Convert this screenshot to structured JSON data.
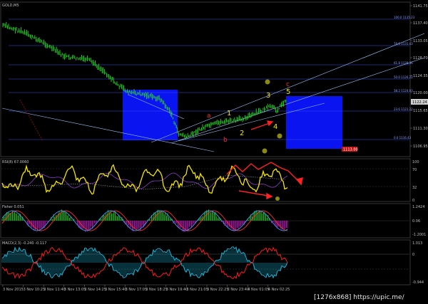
{
  "window": {
    "symbol_title": "GOLD,M5"
  },
  "price_axis": {
    "ticks": [
      "1141.75",
      "1137.40",
      "1133.05",
      "1128.70",
      "1124.35",
      "1120.00",
      "1115.65",
      "1111.30",
      "1106.95"
    ],
    "current_price": "1122.24",
    "pending_label": "1113.00"
  },
  "fib_levels": [
    {
      "label": "100.0 1135.23"
    },
    {
      "label": "78.6 1131.43"
    },
    {
      "label": "61.8 1128.36"
    },
    {
      "label": "50.0 1126.22"
    },
    {
      "label": "38.2 1124.03"
    },
    {
      "label": "23.6 1121.22"
    },
    {
      "label": "0.0 1116.43"
    }
  ],
  "wave_labels": {
    "yellow": [
      "1",
      "2",
      "3",
      "4",
      "5"
    ],
    "red": [
      "a",
      "b",
      "c"
    ]
  },
  "indicators": {
    "rsi": {
      "title": "RSI(8) 67.0060",
      "ticks": [
        "100",
        "70",
        "32",
        "0"
      ]
    },
    "fisher": {
      "title": "Fisher 0.051",
      "ticks": [
        "1.2424",
        "0.06",
        "-1.2001"
      ]
    },
    "macd": {
      "title": "MACD(2,3) -0.240 -0.117",
      "ticks": [
        "1.013",
        "0",
        "-0.944"
      ]
    }
  },
  "time_axis": [
    "3 Nov 2015",
    "3 Nov 10:25",
    "3 Nov 11:40",
    "3 Nov 13:05",
    "3 Nov 14:25",
    "3 Nov 15:40",
    "3 Nov 17:05",
    "3 Nov 18:25",
    "3 Nov 19:40",
    "3 Nov 21:05",
    "3 Nov 22:25",
    "3 Nov 23:40",
    "4 Nov 01:05",
    "4 Nov 02:25"
  ],
  "watermark": "[1276x868] https://upic.me/",
  "colors": {
    "background": "#000000",
    "bull_candle": "#2bd62b",
    "blue_box": "#0a14f0",
    "fib_line": "#3a50e8",
    "trend_line": "#9ec8ff",
    "rsi_line": "#f5e600",
    "red_accent": "#ff2020",
    "olive_marker": "#8a8a14",
    "macd_cyan": "#1ab3d4",
    "macd_red": "#ff1a1a"
  },
  "chart_data": {
    "type": "line",
    "title": "GOLD,M5",
    "xlabel": "",
    "ylabel": "",
    "ylim": [
      1106.95,
      1141.75
    ],
    "x": [
      "3 Nov 2015",
      "3 Nov 10:25",
      "3 Nov 11:40",
      "3 Nov 13:05",
      "3 Nov 14:25",
      "3 Nov 15:40",
      "3 Nov 17:05",
      "3 Nov 18:25",
      "3 Nov 19:40",
      "3 Nov 21:05",
      "3 Nov 22:25",
      "3 Nov 23:40",
      "4 Nov 01:05",
      "4 Nov 02:25"
    ],
    "series": [
      {
        "values": [
          1137.8,
          1135.9,
          1133.4,
          1131.6,
          1128.3,
          1124.6,
          1121.9,
          1119.4,
          1117.0,
          1118.2,
          1119.6,
          1120.8,
          1122.0,
          1123.1
        ]
      }
    ]
  }
}
